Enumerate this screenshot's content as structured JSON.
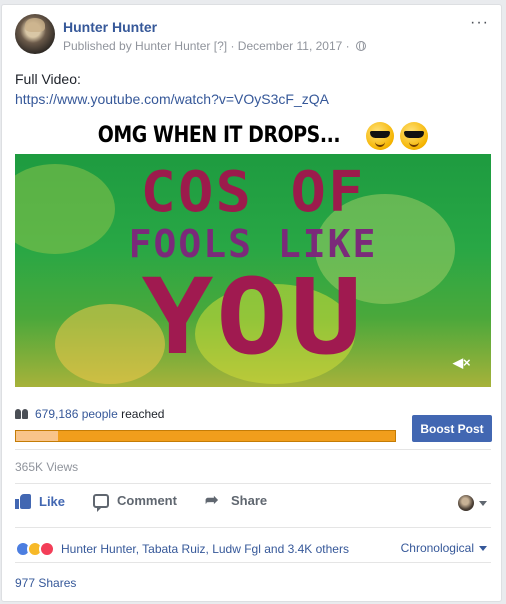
{
  "post": {
    "author": "Hunter Hunter",
    "meta_published": "Published by Hunter Hunter",
    "meta_q": "[?]",
    "meta_sep": "·",
    "meta_date": "December 11, 2017",
    "menu": "···",
    "text_line1": "Full Video:",
    "link": "https://www.youtube.com/watch?v=VOyS3cF_zQA"
  },
  "video": {
    "banner": "OMG WHEN IT DROPS...",
    "line1": "COS OF",
    "line2": "FOOLS LIKE",
    "line3": "YOU",
    "mute_icon": "muted-speaker-icon",
    "mute_glyph": "◀×"
  },
  "reach": {
    "count": "679,186 people",
    "label": "reached",
    "progress_percent": 11,
    "boost_label": "Boost Post"
  },
  "views": "365K Views",
  "actions": {
    "like": "Like",
    "comment": "Comment",
    "share": "Share"
  },
  "reactions": {
    "names": "Hunter Hunter, Tabata Ruiz, Ludw Fgl and 3.4K others",
    "sort": "Chronological"
  },
  "shares": "977 Shares",
  "colors": {
    "brand_blue": "#4267b2",
    "link_blue": "#365899",
    "progress_orange": "#f19e1c"
  }
}
